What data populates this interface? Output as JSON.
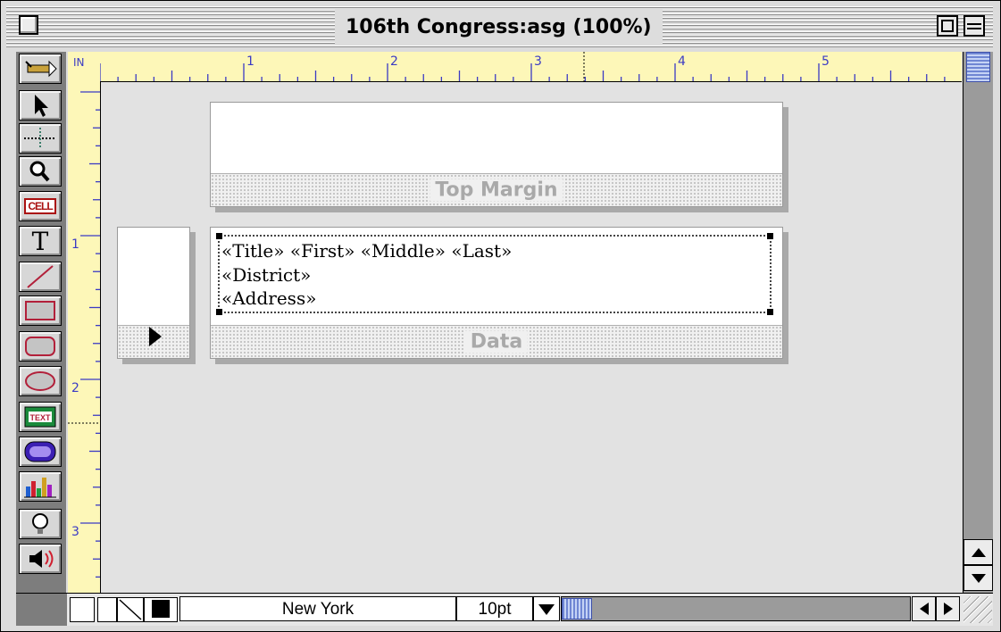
{
  "window": {
    "title": "106th Congress:asg (100%)"
  },
  "ruler": {
    "units": "IN",
    "horizontal_marks": [
      "1",
      "2",
      "3",
      "4",
      "5"
    ],
    "vertical_marks": [
      "1",
      "2",
      "3"
    ]
  },
  "tools": [
    {
      "name": "magic-wand-tool-icon"
    },
    {
      "name": "pointer-tool-icon"
    },
    {
      "name": "grid-tool-icon"
    },
    {
      "name": "magnify-tool-icon"
    },
    {
      "name": "cell-tool-icon",
      "label": "CELL"
    },
    {
      "name": "text-tool-icon",
      "label": "T"
    },
    {
      "name": "line-tool-icon"
    },
    {
      "name": "rectangle-tool-icon"
    },
    {
      "name": "rounded-rectangle-tool-icon"
    },
    {
      "name": "oval-tool-icon"
    },
    {
      "name": "text-editor-tool-icon",
      "label": "TEXT"
    },
    {
      "name": "button-tool-icon"
    },
    {
      "name": "chart-tool-icon"
    },
    {
      "name": "lightbulb-tool-icon"
    },
    {
      "name": "sound-tool-icon"
    }
  ],
  "sections": {
    "top_margin_label": "Top Margin",
    "data_label": "Data",
    "merge_lines": [
      "«Title» «First» «Middle» «Last»",
      "«District»",
      "«Address»"
    ]
  },
  "bottom_bar": {
    "font_name": "New York",
    "font_size": "10pt"
  },
  "colors": {
    "ruler": "#fdf7b8",
    "ruler_text": "#3b3bc4",
    "canvas": "#e2e2e2",
    "scroll_thumb": "#a9bde9"
  }
}
